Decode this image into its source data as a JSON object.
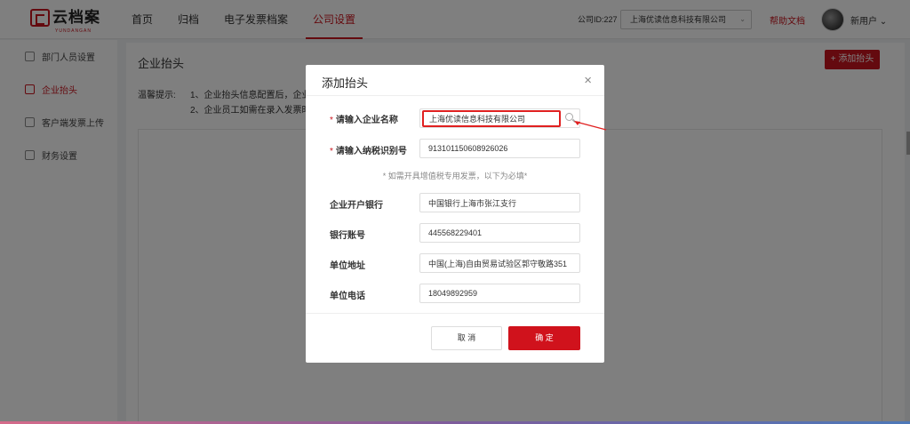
{
  "brand": {
    "logo_text": "云档案",
    "logo_sub": "YUNDANGAN"
  },
  "nav": {
    "items": [
      "首页",
      "归档",
      "电子发票档案",
      "公司设置"
    ],
    "active_index": 3
  },
  "header": {
    "company_id": "公司ID:227",
    "company_select": "上海优读信息科技有限公司",
    "help": "帮助文档",
    "user": "新用户"
  },
  "sidebar": {
    "items": [
      "部门人员设置",
      "企业抬头",
      "客户端发票上传",
      "财务设置"
    ],
    "active_index": 1
  },
  "main": {
    "title": "企业抬头",
    "add_button": "添加抬头",
    "tips_label": "温馨提示:",
    "tips": [
      "1、企业抬头信息配置后，企业",
      "2、企业员工如需在录入发票时"
    ]
  },
  "modal": {
    "title": "添加抬头",
    "fields": [
      {
        "label": "请输入企业名称",
        "required": true,
        "value": "上海优读信息科技有限公司"
      },
      {
        "label": "请输入纳税识别号",
        "required": true,
        "value": "913101150608926026"
      },
      {
        "label": "企业开户银行",
        "required": false,
        "value": "中国银行上海市张江支行"
      },
      {
        "label": "银行账号",
        "required": false,
        "value": "445568229401"
      },
      {
        "label": "单位地址",
        "required": false,
        "value": "中国(上海)自由贸易试验区郭守敬路351"
      },
      {
        "label": "单位电话",
        "required": false,
        "value": "18049892959"
      }
    ],
    "note": "* 如需开具增值税专用发票，以下为必填*",
    "cancel": "取 消",
    "confirm": "确 定"
  },
  "colors": {
    "accent": "#c9151e",
    "highlight": "#e02020"
  }
}
